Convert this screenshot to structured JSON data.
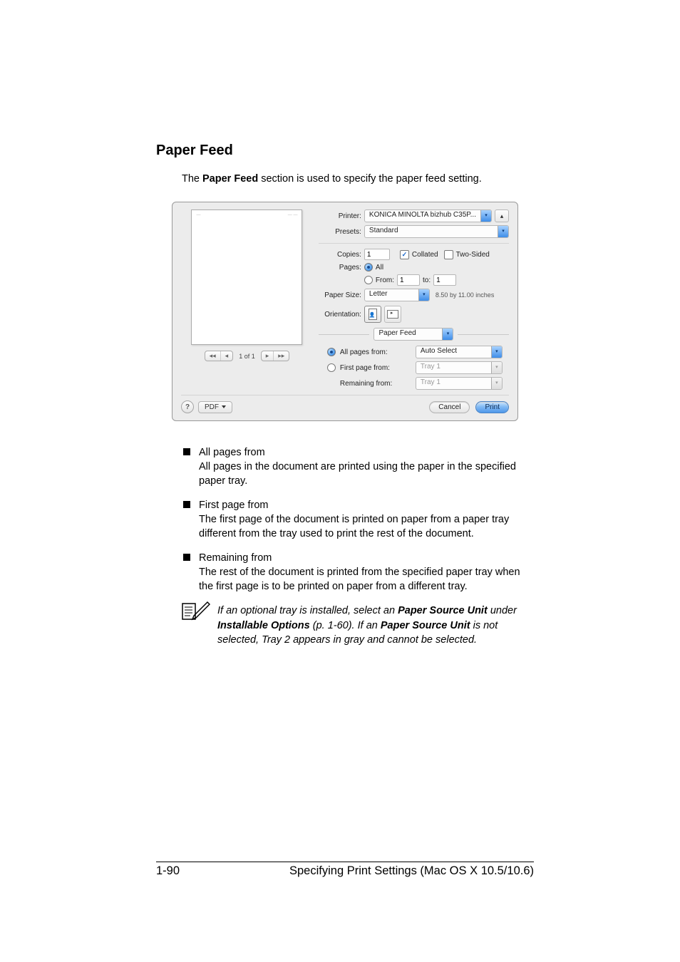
{
  "heading": "Paper Feed",
  "intro_pre": "The ",
  "intro_bold": "Paper Feed",
  "intro_post": " section is used to specify the paper feed setting.",
  "dialog": {
    "labels": {
      "printer": "Printer:",
      "presets": "Presets:",
      "copies": "Copies:",
      "pages": "Pages:",
      "all": "All",
      "from": "From:",
      "to": "to:",
      "paper_size": "Paper Size:",
      "orientation": "Orientation:",
      "collated": "Collated",
      "two_sided": "Two-Sided",
      "section": "Paper Feed",
      "all_pages_from": "All pages from:",
      "first_page_from": "First page from:",
      "remaining_from": "Remaining from:",
      "help": "?",
      "pdf": "PDF",
      "cancel": "Cancel",
      "print": "Print"
    },
    "values": {
      "printer": "KONICA MINOLTA bizhub C35P...",
      "presets": "Standard",
      "copies": "1",
      "from": "1",
      "to": "1",
      "paper_size": "Letter",
      "paper_dim": "8.50 by 11.00 inches",
      "all_pages_from": "Auto Select",
      "first_page_from": "Tray 1",
      "remaining_from": "Tray 1",
      "page_counter": "1 of 1"
    }
  },
  "items": [
    {
      "title": "All pages from",
      "body": "All pages in the document are printed using the paper in the specified paper tray."
    },
    {
      "title": "First page from",
      "body": "The first page of the document is printed on paper from a paper tray different from the tray used to print the rest of the document."
    },
    {
      "title": "Remaining from",
      "body": "The rest of the document is printed from the specified paper tray when the first page is to be printed on paper from a different tray."
    }
  ],
  "note": {
    "p1_pre": "If an optional tray is installed, select an ",
    "p1_b1": "Paper Source Unit",
    "p1_mid": " under ",
    "p1_b2": "Installable Options",
    "p1_post": " (p. 1-60). If an ",
    "p1_b3": "Paper Source Unit",
    "p1_tail": " is not selected, Tray 2 appears in gray and cannot be selected."
  },
  "footer": {
    "page": "1-90",
    "title": "Specifying Print Settings (Mac OS X 10.5/10.6)"
  }
}
